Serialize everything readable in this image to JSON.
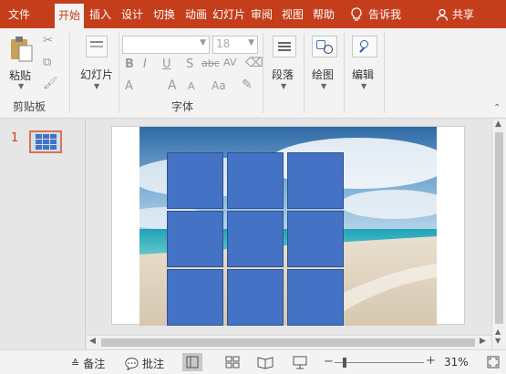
{
  "tabs": [
    {
      "label": "文件",
      "active": false
    },
    {
      "label": "开始",
      "active": true
    },
    {
      "label": "插入",
      "active": false
    },
    {
      "label": "设计",
      "active": false
    },
    {
      "label": "切换",
      "active": false
    },
    {
      "label": "动画",
      "active": false
    },
    {
      "label": "幻灯片",
      "active": false
    },
    {
      "label": "审阅",
      "active": false
    },
    {
      "label": "视图",
      "active": false
    },
    {
      "label": "帮助",
      "active": false
    }
  ],
  "tell_me": "告诉我",
  "share": "共享",
  "ribbon": {
    "paste_label": "粘贴",
    "clipboard_group": "剪贴板",
    "slide_label": "幻灯片",
    "font_size": "18",
    "font_group": "字体",
    "paragraph_label": "段落",
    "drawing_label": "绘图",
    "editing_label": "编辑",
    "bold": "B",
    "italic": "I",
    "underline": "U",
    "strike": "S",
    "spacing": "abc",
    "caseAV": "AV",
    "fontA": "A",
    "grow": "A",
    "shrink": "A",
    "clearAa": "Aa"
  },
  "slide_number": "1",
  "status": {
    "notes": "备注",
    "comments": "批注",
    "zoom": "31%"
  },
  "colors": {
    "brand": "#c43e1c",
    "tile": "#4472c4"
  }
}
